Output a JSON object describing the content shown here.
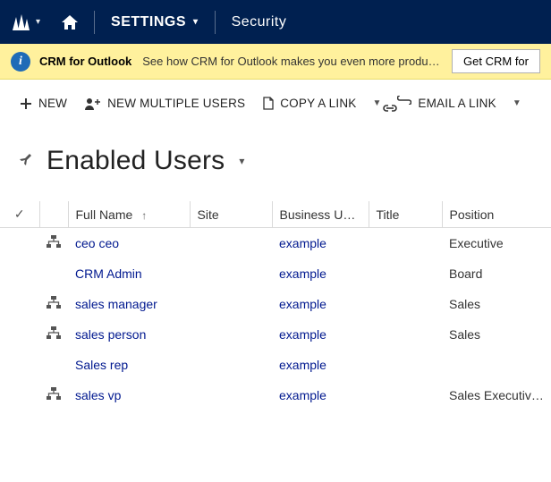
{
  "nav": {
    "settings_label": "SETTINGS",
    "security_label": "Security"
  },
  "notification": {
    "title": "CRM for Outlook",
    "message": "See how CRM for Outlook makes you even more productive.",
    "button_label": "Get CRM for"
  },
  "commands": {
    "new": "NEW",
    "new_multiple": "NEW MULTIPLE USERS",
    "copy_link": "COPY A LINK",
    "email_link": "EMAIL A LINK"
  },
  "view": {
    "title": "Enabled Users"
  },
  "grid": {
    "columns": {
      "full_name": "Full Name",
      "site": "Site",
      "business_unit": "Business Unit…",
      "title": "Title",
      "position": "Position"
    },
    "rows": [
      {
        "hierarchy": true,
        "full_name": "ceo ceo",
        "site": "",
        "business_unit": "example",
        "title": "",
        "position": "Executive"
      },
      {
        "hierarchy": false,
        "full_name": "CRM Admin",
        "site": "",
        "business_unit": "example",
        "title": "",
        "position": "Board"
      },
      {
        "hierarchy": true,
        "full_name": "sales manager",
        "site": "",
        "business_unit": "example",
        "title": "",
        "position": "Sales"
      },
      {
        "hierarchy": true,
        "full_name": "sales person",
        "site": "",
        "business_unit": "example",
        "title": "",
        "position": "Sales"
      },
      {
        "hierarchy": false,
        "full_name": "Sales rep",
        "site": "",
        "business_unit": "example",
        "title": "",
        "position": ""
      },
      {
        "hierarchy": true,
        "full_name": "sales vp",
        "site": "",
        "business_unit": "example",
        "title": "",
        "position": "Sales Executives"
      }
    ]
  }
}
